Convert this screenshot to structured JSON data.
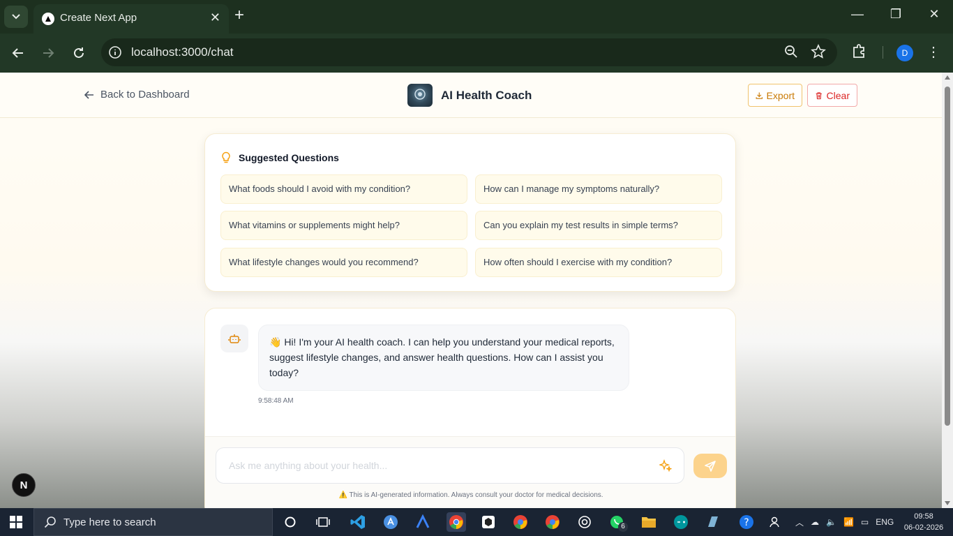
{
  "browser": {
    "tab_title": "Create Next App",
    "url": "localhost:3000/chat",
    "profile_initial": "D"
  },
  "header": {
    "back_label": "Back to Dashboard",
    "title": "AI Health Coach",
    "export_label": "Export",
    "clear_label": "Clear"
  },
  "suggestions": {
    "heading": "Suggested Questions",
    "items": [
      "What foods should I avoid with my condition?",
      "How can I manage my symptoms naturally?",
      "What vitamins or supplements might help?",
      "Can you explain my test results in simple terms?",
      "What lifestyle changes would you recommend?",
      "How often should I exercise with my condition?"
    ]
  },
  "chat": {
    "messages": [
      {
        "role": "assistant",
        "emoji": "👋",
        "text": "Hi! I'm your AI health coach. I can help you understand your medical reports, suggest lifestyle changes, and answer health questions. How can I assist you today?",
        "time": "9:58:48 AM"
      }
    ],
    "input_placeholder": "Ask me anything about your health...",
    "disclaimer": "This is AI-generated information. Always consult your doctor for medical decisions."
  },
  "dev": {
    "next_badge": "N"
  },
  "taskbar": {
    "search_placeholder": "Type here to search",
    "whatsapp_badge": "6",
    "language": "ENG",
    "time": "09:58",
    "date": "06-02-2026"
  },
  "colors": {
    "accent": "#f59e0b",
    "clear_red": "#dc2626",
    "send_button": "#fcd38c"
  }
}
